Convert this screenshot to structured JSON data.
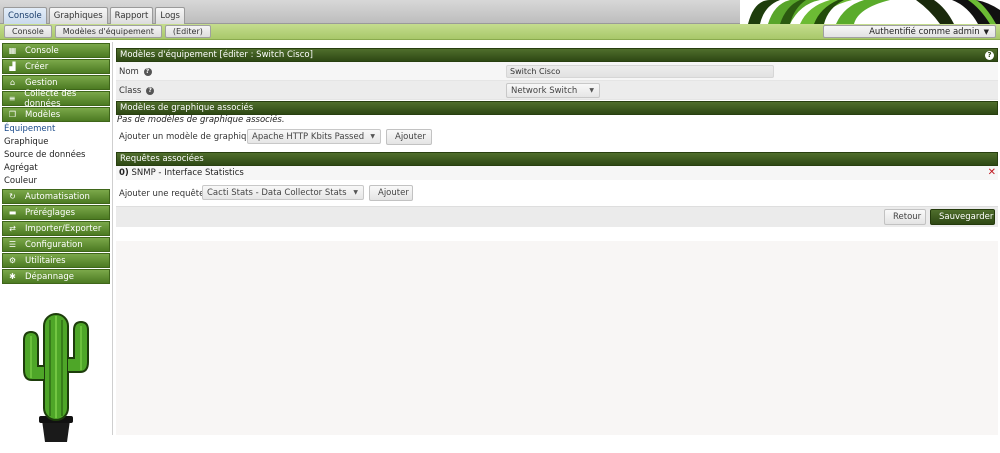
{
  "tabs": [
    {
      "label": "Console",
      "active": true
    },
    {
      "label": "Graphiques",
      "active": false
    },
    {
      "label": "Rapport",
      "active": false
    },
    {
      "label": "Logs",
      "active": false
    }
  ],
  "breadcrumb": [
    "Console",
    "Modèles d'équipement",
    "(Editer)"
  ],
  "auth": {
    "label": "Authentifié comme admin"
  },
  "sidebar": {
    "sections": [
      {
        "label": "Console",
        "icon": "map-icon"
      },
      {
        "label": "Créer",
        "icon": "chart-icon"
      },
      {
        "label": "Gestion",
        "icon": "home-icon"
      },
      {
        "label": "Collecte des données",
        "icon": "database-icon"
      },
      {
        "label": "Modèles",
        "icon": "copy-icon"
      }
    ],
    "sub_items": [
      {
        "label": "Équipement",
        "selected": true
      },
      {
        "label": "Graphique",
        "selected": false
      },
      {
        "label": "Source de données",
        "selected": false
      },
      {
        "label": "Agrégat",
        "selected": false
      },
      {
        "label": "Couleur",
        "selected": false
      }
    ],
    "sections_after": [
      {
        "label": "Automatisation",
        "icon": "refresh-icon"
      },
      {
        "label": "Préréglages",
        "icon": "archive-icon"
      },
      {
        "label": "Importer/Exporter",
        "icon": "exchange-icon"
      },
      {
        "label": "Configuration",
        "icon": "sliders-icon"
      },
      {
        "label": "Utilitaires",
        "icon": "gears-icon"
      },
      {
        "label": "Dépannage",
        "icon": "bug-icon"
      }
    ]
  },
  "main": {
    "header": "Modèles d'équipement [éditer : Switch Cisco]",
    "fields": {
      "nom_label": "Nom",
      "nom_value": "Switch Cisco",
      "class_label": "Class",
      "class_value": "Network Switch"
    },
    "graph_section": {
      "header": "Modèles de graphique associés",
      "empty_message": "Pas de modèles de graphique associés.",
      "add_label": "Ajouter un modèle de graphique",
      "add_select": "Apache HTTP Kbits Passed",
      "add_button": "Ajouter"
    },
    "query_section": {
      "header": "Requêtes associées",
      "query_index": "0)",
      "query_name": "SNMP - Interface Statistics",
      "add_label": "Ajouter une requête",
      "add_select": "Cacti Stats - Data Collector Stats",
      "add_button": "Ajouter"
    },
    "actions": {
      "back": "Retour",
      "save": "Sauvegarder"
    }
  },
  "colors": {
    "header_green": "#2e4814",
    "menu_green": "#4c7a22",
    "breadcrumb_green": "#a8c86a",
    "delete_red": "#c0171f"
  }
}
